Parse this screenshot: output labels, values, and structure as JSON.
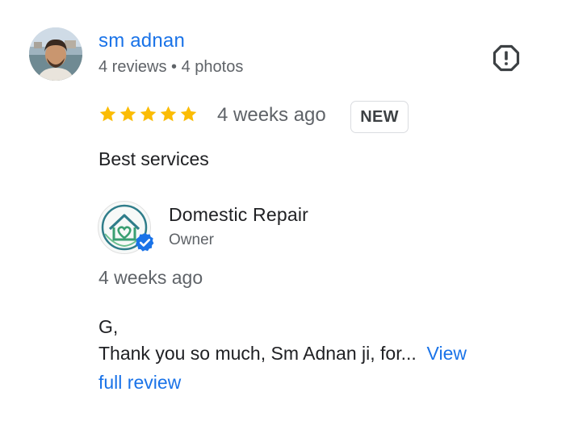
{
  "reviewer": {
    "name": "sm adnan",
    "meta": "4 reviews • 4 photos"
  },
  "review": {
    "rating": 5,
    "rating_max": 5,
    "time": "4 weeks ago",
    "badge": "NEW",
    "text": "Best services"
  },
  "owner_reply": {
    "name": "Domestic Repair",
    "role": "Owner",
    "time": "4 weeks ago",
    "line1": "G,",
    "line2": "Thank you so much, Sm Adnan ji, for...",
    "view_link_part1": "View",
    "view_link_part2": "full review"
  },
  "colors": {
    "link": "#1a73e8",
    "star": "#fbbc04",
    "verified": "#1a73e8"
  },
  "icons": {
    "report": "report-flag-icon",
    "star": "star-icon",
    "verified": "verified-badge-icon"
  }
}
